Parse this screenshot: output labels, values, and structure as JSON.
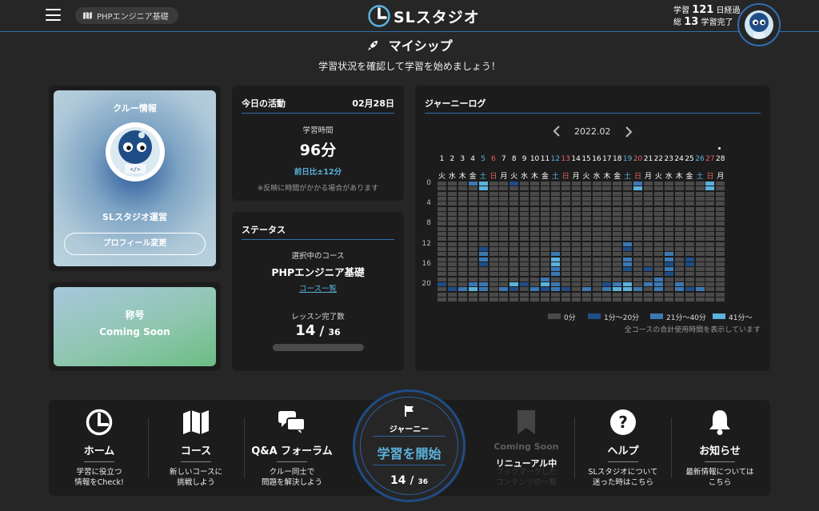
{
  "header": {
    "course_name": "PHPエンジニア基礎",
    "logo_text": "スタジオ",
    "stats_line1_prefix": "学習",
    "stats_days": "121",
    "stats_line1_suffix": "日経過",
    "stats_line2_prefix": "総",
    "stats_lessons": "13",
    "stats_line2_suffix": "学習完了"
  },
  "page": {
    "title": "マイシップ",
    "subtitle": "学習状況を確認して学習を始めましょう！"
  },
  "crew": {
    "heading": "クルー情報",
    "name": "SLスタジオ運営",
    "profile_button": "プロフィール変更"
  },
  "honor": {
    "heading": "称号",
    "value": "Coming Soon"
  },
  "today": {
    "heading": "今日の活動",
    "date": "02月28日",
    "study_time_label": "学習時間",
    "study_time_value": "96分",
    "compare": "前日比±12分",
    "note": "※反映に時間がかかる場合があります"
  },
  "status": {
    "heading": "ステータス",
    "selected_course_label": "選択中のコース",
    "selected_course": "PHPエンジニア基礎",
    "course_list_link": "コース一覧",
    "lessons_done_label": "レッスン完了数",
    "lessons_done": "14",
    "lessons_sep": "/",
    "lessons_total": "36",
    "progress": 0.39
  },
  "journey": {
    "heading": "ジャーニーログ",
    "month": "2022.02",
    "days": [
      "1",
      "2",
      "3",
      "4",
      "5",
      "6",
      "7",
      "8",
      "9",
      "10",
      "11",
      "12",
      "13",
      "14",
      "15",
      "16",
      "17",
      "18",
      "19",
      "20",
      "21",
      "22",
      "23",
      "24",
      "25",
      "26",
      "27",
      "28"
    ],
    "weekdays": [
      "火",
      "水",
      "木",
      "金",
      "土",
      "日",
      "月",
      "火",
      "水",
      "木",
      "金",
      "土",
      "日",
      "月",
      "火",
      "水",
      "木",
      "金",
      "土",
      "日",
      "月",
      "火",
      "水",
      "木",
      "金",
      "土",
      "日",
      "月"
    ],
    "hour_labels": [
      "0",
      "4",
      "8",
      "12",
      "16",
      "20"
    ],
    "legend": [
      "0分",
      "1分〜20分",
      "21分〜40分",
      "41分〜"
    ],
    "legend_colors": [
      "#4a4a4b",
      "#1f4d86",
      "#3c79b3",
      "#5bb2da"
    ],
    "footnote": "全コースの合計使用時間を表示しています",
    "cells": [
      [
        4,
        0,
        2
      ],
      [
        5,
        0,
        3
      ],
      [
        5,
        1,
        3
      ],
      [
        8,
        0,
        1
      ],
      [
        20,
        0,
        2
      ],
      [
        20,
        1,
        3
      ],
      [
        27,
        0,
        3
      ],
      [
        27,
        1,
        3
      ],
      [
        5,
        13,
        1
      ],
      [
        5,
        14,
        2
      ],
      [
        5,
        15,
        2
      ],
      [
        5,
        16,
        1
      ],
      [
        12,
        14,
        2
      ],
      [
        12,
        15,
        3
      ],
      [
        12,
        16,
        3
      ],
      [
        12,
        17,
        2
      ],
      [
        12,
        18,
        2
      ],
      [
        19,
        12,
        2
      ],
      [
        19,
        13,
        1
      ],
      [
        19,
        15,
        2
      ],
      [
        19,
        16,
        2
      ],
      [
        19,
        17,
        1
      ],
      [
        21,
        17,
        1
      ],
      [
        21,
        20,
        2
      ],
      [
        22,
        19,
        2
      ],
      [
        22,
        20,
        2
      ],
      [
        22,
        21,
        2
      ],
      [
        23,
        14,
        2
      ],
      [
        23,
        15,
        2
      ],
      [
        23,
        16,
        1
      ],
      [
        23,
        17,
        2
      ],
      [
        23,
        18,
        1
      ],
      [
        24,
        20,
        2
      ],
      [
        24,
        21,
        2
      ],
      [
        25,
        15,
        1
      ],
      [
        25,
        16,
        1
      ],
      [
        25,
        21,
        1
      ],
      [
        26,
        21,
        2
      ],
      [
        1,
        20,
        1
      ],
      [
        2,
        21,
        1
      ],
      [
        3,
        21,
        2
      ],
      [
        4,
        20,
        2
      ],
      [
        4,
        21,
        3
      ],
      [
        5,
        20,
        2
      ],
      [
        5,
        21,
        2
      ],
      [
        7,
        21,
        2
      ],
      [
        8,
        20,
        3
      ],
      [
        8,
        21,
        1
      ],
      [
        9,
        20,
        1
      ],
      [
        10,
        21,
        2
      ],
      [
        11,
        19,
        2
      ],
      [
        11,
        20,
        3
      ],
      [
        11,
        21,
        1
      ],
      [
        12,
        20,
        2
      ],
      [
        12,
        21,
        2
      ],
      [
        13,
        21,
        1
      ],
      [
        15,
        21,
        2
      ],
      [
        17,
        20,
        1
      ],
      [
        17,
        21,
        2
      ],
      [
        18,
        20,
        2
      ],
      [
        18,
        21,
        3
      ],
      [
        19,
        20,
        3
      ],
      [
        19,
        21,
        3
      ],
      [
        20,
        21,
        2
      ]
    ]
  },
  "nav": {
    "home_label": "ホーム",
    "home_desc": "学習に役立つ\n情報をCheck!",
    "course_label": "コース",
    "course_desc": "新しいコースに\n挑戦しよう",
    "qa_label": "Q&A フォーラム",
    "qa_desc": "クルー同士で\n問題を解決しよう",
    "journey_label": "ジャーニー",
    "start_label": "学習を開始",
    "start_done": "14",
    "start_sep": "/",
    "start_total": "36",
    "soon_label": "Coming Soon",
    "soon_sub": "リニューアル中",
    "soon_desc": "ブックマークした\nコンテンツの一覧",
    "help_label": "ヘルプ",
    "help_desc": "SLスタジオについて\n迷った時はこちら",
    "news_label": "お知らせ",
    "news_desc": "最新情報については\nこちら"
  }
}
